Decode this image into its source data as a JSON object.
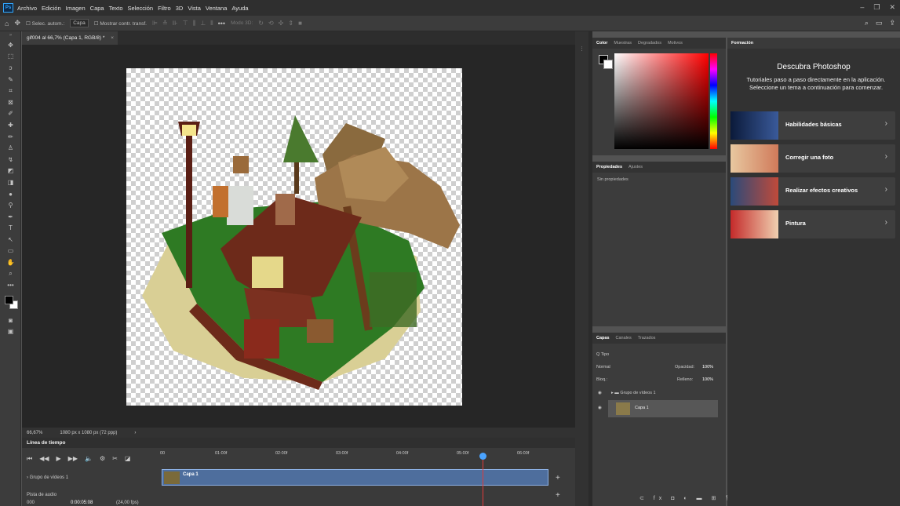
{
  "app": {
    "logo": "Ps"
  },
  "menu": [
    "Archivo",
    "Edición",
    "Imagen",
    "Capa",
    "Texto",
    "Selección",
    "Filtro",
    "3D",
    "Vista",
    "Ventana",
    "Ayuda"
  ],
  "options": {
    "auto_select": "Selec. autom.:",
    "layer_select": "Capa",
    "transform_controls": "Mostrar contr. transf.",
    "mode_3d": "Modo 3D:"
  },
  "document": {
    "tab_title": "gif004 al 66,7% (Capa 1, RGB/8) *",
    "close": "×"
  },
  "status": {
    "zoom": "66,67%",
    "size": "1080 px x 1080 px (72 ppp)"
  },
  "timeline": {
    "title": "Línea de tiempo",
    "ruler": [
      "00",
      "01:00f",
      "02:00f",
      "03:00f",
      "04:00f",
      "05:00f",
      "06:00f"
    ],
    "group_label": "Grupo de vídeos 1",
    "clip_label": "Capa 1",
    "audio_label": "Pista de audio",
    "frame": "000",
    "timecode": "0:00:05:08",
    "fps": "(24,00 fps)"
  },
  "color_panel": {
    "tabs": [
      "Color",
      "Muestras",
      "Degradados",
      "Motivos"
    ]
  },
  "props_panel": {
    "tabs": [
      "Propiedades",
      "Ajustes"
    ],
    "empty": "Sin propiedades"
  },
  "layers_panel": {
    "tabs": [
      "Capas",
      "Canales",
      "Trazados"
    ],
    "filter": "Q Tipo",
    "blend": "Normal",
    "opacity_label": "Opacidad:",
    "opacity": "100%",
    "lock_label": "Bloq.:",
    "fill_label": "Relleno:",
    "fill": "100%",
    "group": "Grupo de vídeos 1",
    "layer": "Capa 1"
  },
  "learn": {
    "tab": "Formación",
    "title": "Descubra Photoshop",
    "desc": "Tutoriales paso a paso directamente en la aplicación. Seleccione un tema a continuación para comenzar.",
    "cards": [
      "Habilidades básicas",
      "Corregir una foto",
      "Realizar efectos creativos",
      "Pintura"
    ]
  },
  "colors": {
    "accent": "#31a8ff",
    "playhead": "#4aa3ff",
    "clip": "#4e6e9d"
  }
}
